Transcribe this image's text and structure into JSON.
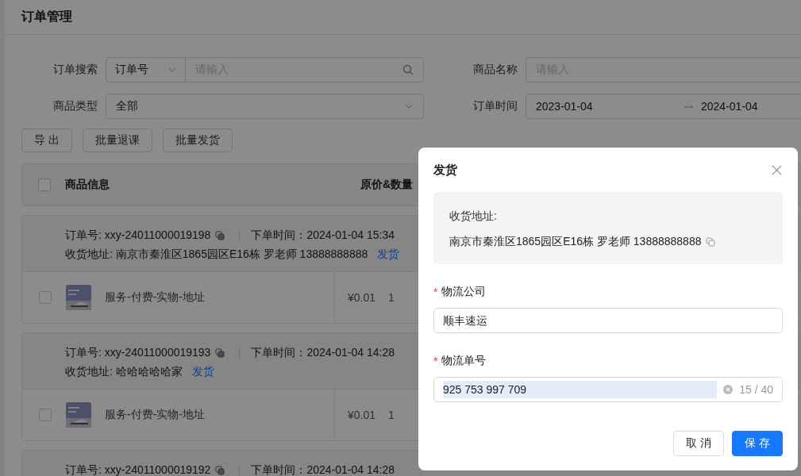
{
  "page": {
    "title": "订单管理"
  },
  "filters": [
    {
      "kind": "search",
      "label": "订单搜索",
      "select": "订单号",
      "placeholder": "请输入"
    },
    {
      "kind": "text",
      "label": "商品名称",
      "placeholder": "请输入"
    },
    {
      "kind": "select",
      "label": "商品类型",
      "value": "全部"
    },
    {
      "kind": "daterange",
      "label": "订单时间",
      "start": "2023-01-04",
      "end": "2024-01-04"
    }
  ],
  "actions": [
    "导 出",
    "批量退课",
    "批量发货"
  ],
  "table": {
    "checked": false,
    "columns": [
      "商品信息",
      "原价&数量"
    ]
  },
  "orders": [
    {
      "order_no": "订单号: xxy-24011000019198",
      "time": "下单时间：2024-01-04 15:34",
      "address": "收货地址: 南京市秦淮区1865园区E16栋 罗老师 13888888888",
      "ship": "发货",
      "items": [
        {
          "checked": false,
          "name": "服务-付费-实物-地址",
          "price": "¥0.01",
          "qty": "1"
        }
      ]
    },
    {
      "order_no": "订单号: xxy-24011000019193",
      "time": "下单时间：2024-01-04 14:28",
      "address": "收货地址: 哈哈哈哈哈家",
      "ship": "发货",
      "items": [
        {
          "checked": false,
          "name": "服务-付费-实物-地址",
          "price": "¥0.01",
          "qty": "1"
        }
      ]
    },
    {
      "order_no": "订单号: xxy-24011000019192",
      "time": "下单时间：2024-01-04 14:28"
    }
  ],
  "dialog": {
    "title": "发货",
    "address_label": "收货地址:",
    "address": "南京市秦淮区1865园区E16栋 罗老师 13888888888",
    "fields": [
      {
        "label": "物流公司",
        "required_mark": "*",
        "value": "顺丰速运",
        "text_selected": false
      },
      {
        "label": "物流单号",
        "required_mark": "*",
        "value": "925 753 997 709",
        "text_selected": true,
        "count": "15 / 40"
      }
    ],
    "buttons": [
      {
        "kind": "default",
        "label": "取 消"
      },
      {
        "kind": "primary",
        "label": "保 存"
      }
    ]
  }
}
